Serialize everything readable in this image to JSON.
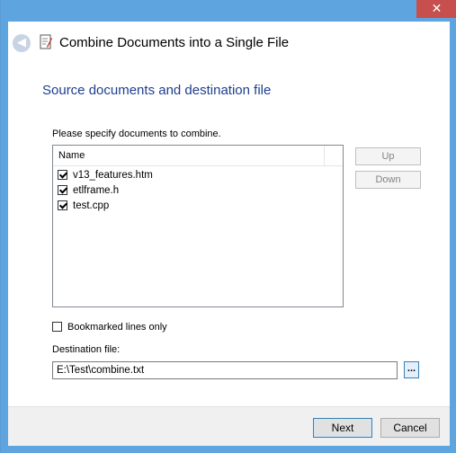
{
  "window": {
    "close_glyph": "✕",
    "frame_color": "#5ea5e0",
    "close_color": "#c7504e"
  },
  "header": {
    "back_glyph": "◀",
    "title": "Combine Documents into a Single File"
  },
  "page": {
    "section_title": "Source documents and destination file",
    "instructions": "Please specify documents to combine."
  },
  "list": {
    "column_name": "Name",
    "items": [
      {
        "label": "v13_features.htm",
        "checked": true
      },
      {
        "label": "etlframe.h",
        "checked": true
      },
      {
        "label": "test.cpp",
        "checked": true
      }
    ]
  },
  "side_buttons": {
    "up": "Up",
    "down": "Down"
  },
  "options": {
    "bookmarked_label": "Bookmarked lines only",
    "bookmarked_checked": false
  },
  "destination": {
    "label": "Destination file:",
    "value": "E:\\Test\\combine.txt",
    "browse_label": "..."
  },
  "footer": {
    "next": "Next",
    "cancel": "Cancel"
  }
}
